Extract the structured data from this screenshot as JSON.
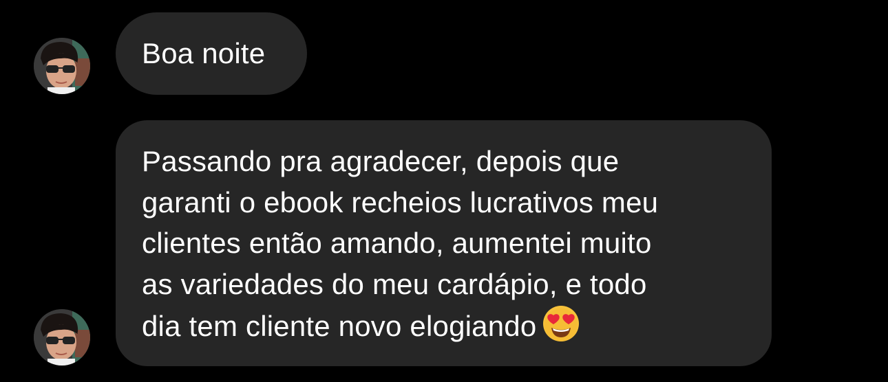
{
  "conversation": {
    "messages": [
      {
        "text": "Boa noite",
        "avatar_icon": "user-avatar-icon"
      },
      {
        "text": "Passando pra agradecer, depois que\ngaranti o ebook recheios lucrativos meu\nclientes então amando, aumentei muito\nas variedades do meu cardápio, e todo\ndia tem cliente novo elogiando",
        "emoji_icon": "heart-eyes-emoji-icon",
        "avatar_icon": "user-avatar-icon"
      }
    ]
  },
  "colors": {
    "background": "#000000",
    "bubble": "#262626",
    "text": "#ffffff",
    "emoji_face": "#f7c23b",
    "emoji_heart": "#e8283a"
  }
}
